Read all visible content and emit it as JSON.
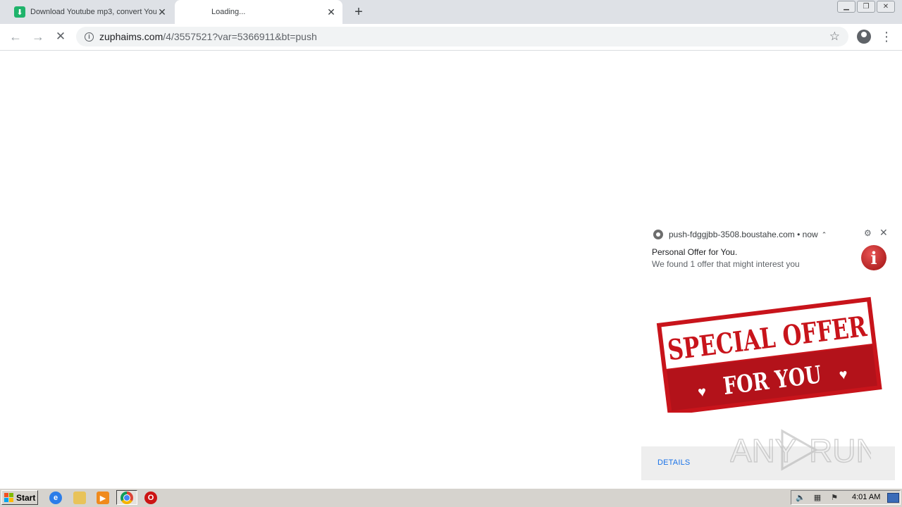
{
  "browser": {
    "tabs": [
      {
        "title": "Download Youtube mp3, convert You",
        "active": false
      },
      {
        "title": "Loading...",
        "active": true
      }
    ],
    "new_tab_glyph": "+",
    "close_glyph": "✕",
    "window_controls": [
      "minimize",
      "restore",
      "close"
    ],
    "address": {
      "host": "zuphaims.com",
      "path": "/4/3557521?var=5366911&bt=push"
    },
    "icons": {
      "back": "back-arrow-icon",
      "forward": "forward-arrow-icon",
      "reload": "stop-loading-icon",
      "info": "info-icon",
      "bookmark": "star-icon",
      "profile": "account-icon",
      "menu": "kebab-menu-icon"
    }
  },
  "notification": {
    "origin": "push-fdggjbb-3508.boustahe.com",
    "time": "now",
    "title": "Personal Offer for You.",
    "message": "We found 1 offer that might interest you",
    "image": {
      "line1": "SPECIAL OFFER",
      "line2": "FOR YOU",
      "color": "#c8141b"
    },
    "action": "DETAILS"
  },
  "watermark": {
    "text_left": "ANY",
    "text_right": "RUN"
  },
  "taskbar": {
    "start_label": "Start",
    "pinned": [
      "internet-explorer-icon",
      "folder-icon",
      "media-player-icon",
      "chrome-icon",
      "opera-icon"
    ],
    "clock": "4:01 AM"
  }
}
